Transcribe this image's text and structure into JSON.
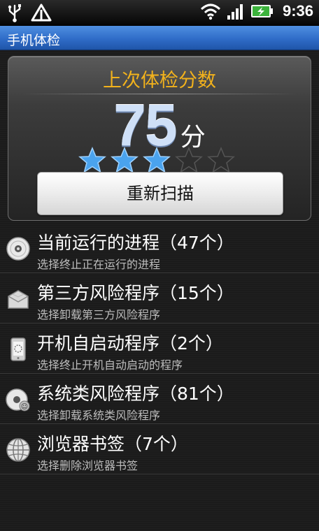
{
  "status_bar": {
    "time": "9:36",
    "icons": [
      "usb-icon",
      "warning-icon",
      "wifi-icon",
      "signal-icon",
      "battery-icon"
    ]
  },
  "title_bar": {
    "title": "手机体检"
  },
  "score_card": {
    "title": "上次体检分数",
    "score": "75",
    "unit": "分",
    "stars_total": 5,
    "stars_filled": 3,
    "rescan_label": "重新扫描"
  },
  "items": [
    {
      "title": "当前运行的进程（47个）",
      "subtitle": "选择终止正在运行的进程",
      "icon": "disc-icon"
    },
    {
      "title": "第三方风险程序（15个）",
      "subtitle": "选择卸载第三方风险程序",
      "icon": "package-icon"
    },
    {
      "title": "开机自启动程序（2个）",
      "subtitle": "选择终止开机自动启动的程序",
      "icon": "phone-icon"
    },
    {
      "title": "系统类风险程序（81个）",
      "subtitle": "选择卸载系统类风险程序",
      "icon": "disc-warning-icon"
    },
    {
      "title": "浏览器书签（7个）",
      "subtitle": "选择删除浏览器书签",
      "icon": "globe-icon"
    }
  ],
  "colors": {
    "accent_title": "#f2b21c",
    "titlebar_blue": "#2f6cc8",
    "star_blue": "#4aa3ee"
  }
}
